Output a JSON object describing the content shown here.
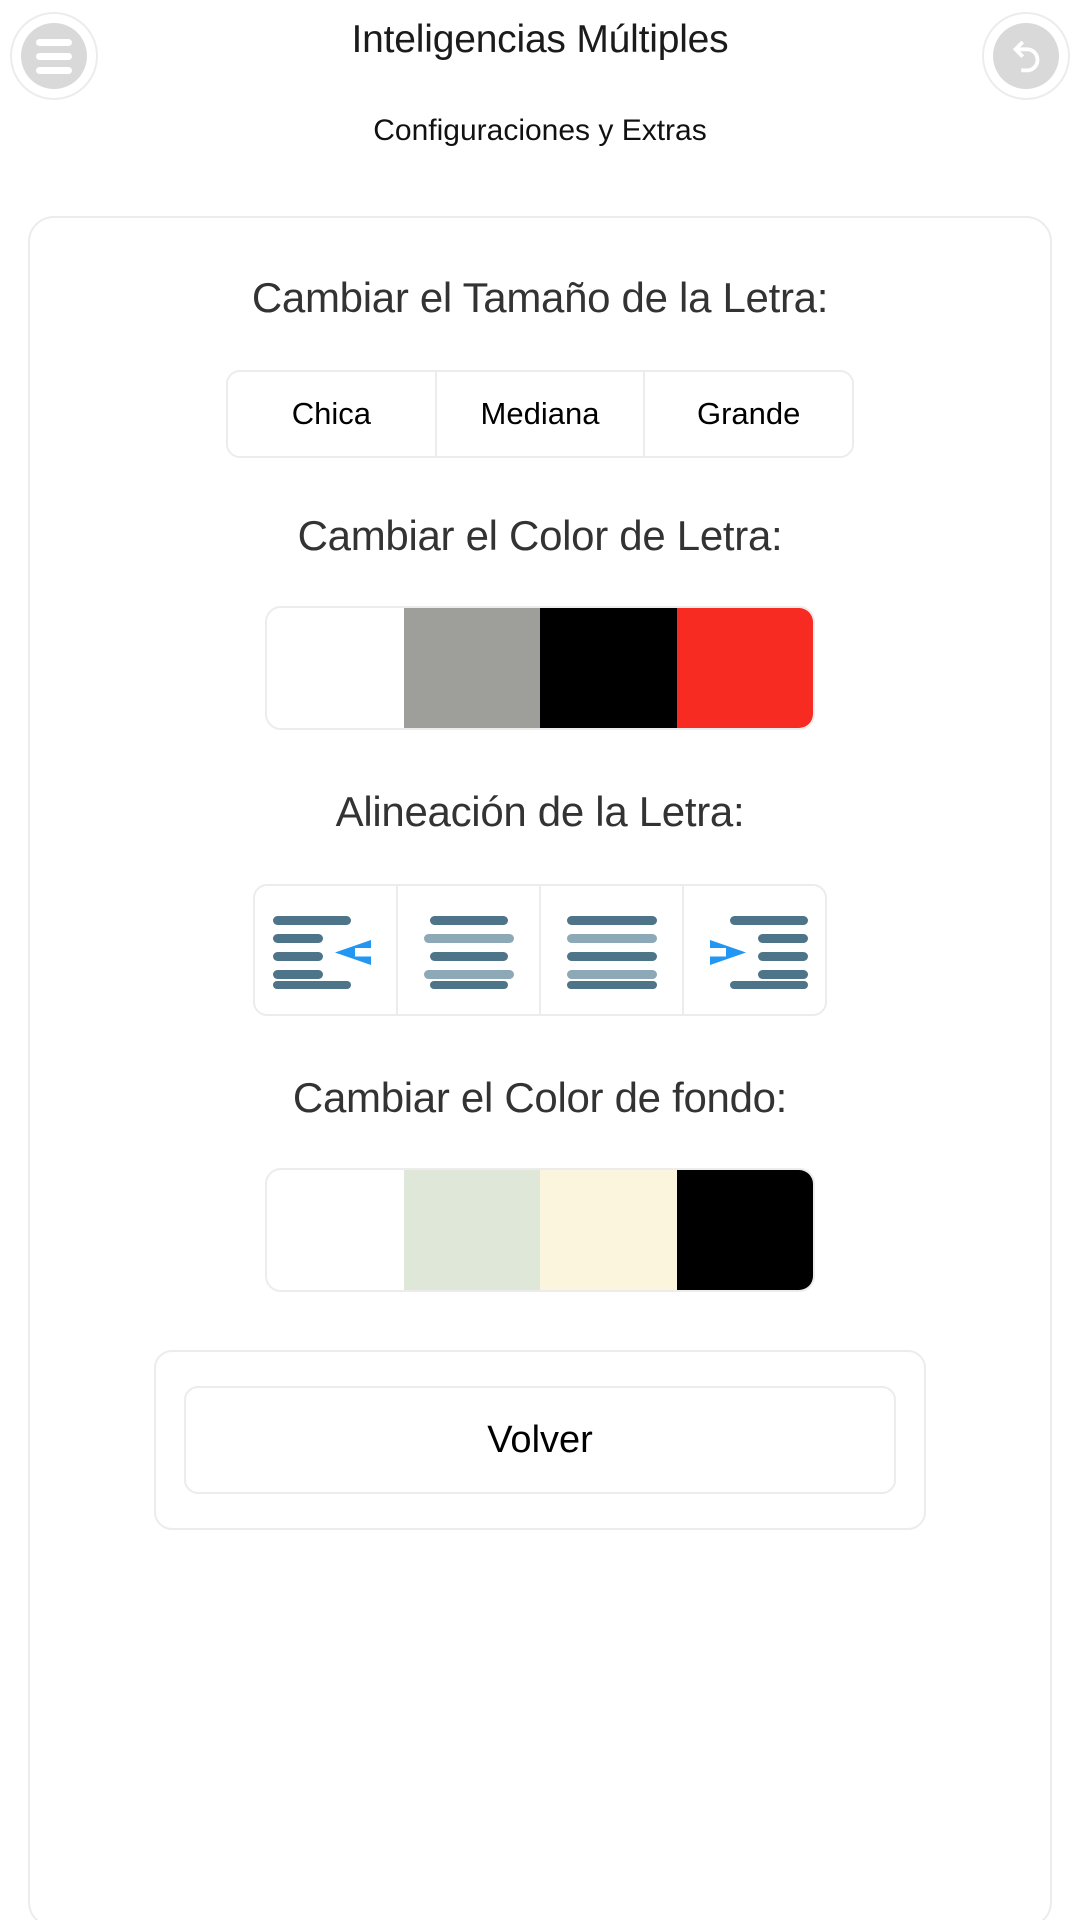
{
  "header": {
    "title": "Inteligencias Múltiples",
    "subtitle": "Configuraciones y Extras",
    "menu_icon": "hamburger-menu-icon",
    "back_icon": "undo-back-arrow-icon"
  },
  "sections": {
    "font_size": {
      "title": "Cambiar el Tamaño de la Letra:",
      "options": [
        {
          "label": "Chica"
        },
        {
          "label": "Mediana"
        },
        {
          "label": "Grande"
        }
      ]
    },
    "font_color": {
      "title": "Cambiar el Color de Letra:",
      "swatches": [
        {
          "name": "white",
          "color": "#ffffff"
        },
        {
          "name": "gray",
          "color": "#9e9e9b"
        },
        {
          "name": "black",
          "color": "#000000"
        },
        {
          "name": "red",
          "color": "#f82b22"
        }
      ]
    },
    "alignment": {
      "title": "Alineación de la Letra:",
      "options": [
        {
          "name": "align-left-icon",
          "arrow": "left"
        },
        {
          "name": "align-center-icon",
          "arrow": "none"
        },
        {
          "name": "align-justify-icon",
          "arrow": "none"
        },
        {
          "name": "align-right-icon",
          "arrow": "right"
        }
      ],
      "bar_color_dark": "#4e7489",
      "bar_color_light": "#8da8b6",
      "arrow_color": "#2196f3"
    },
    "background_color": {
      "title": "Cambiar el Color de fondo:",
      "swatches": [
        {
          "name": "white",
          "color": "#ffffff"
        },
        {
          "name": "light-green",
          "color": "#dfe8d8"
        },
        {
          "name": "cream",
          "color": "#faf5dc"
        },
        {
          "name": "black",
          "color": "#000000"
        }
      ]
    }
  },
  "footer": {
    "back_label": "Volver"
  },
  "theme": {
    "border": "#ececec",
    "heading_text": "#333333",
    "body_text": "#000000",
    "icon_disc": "#d9d9d9"
  }
}
